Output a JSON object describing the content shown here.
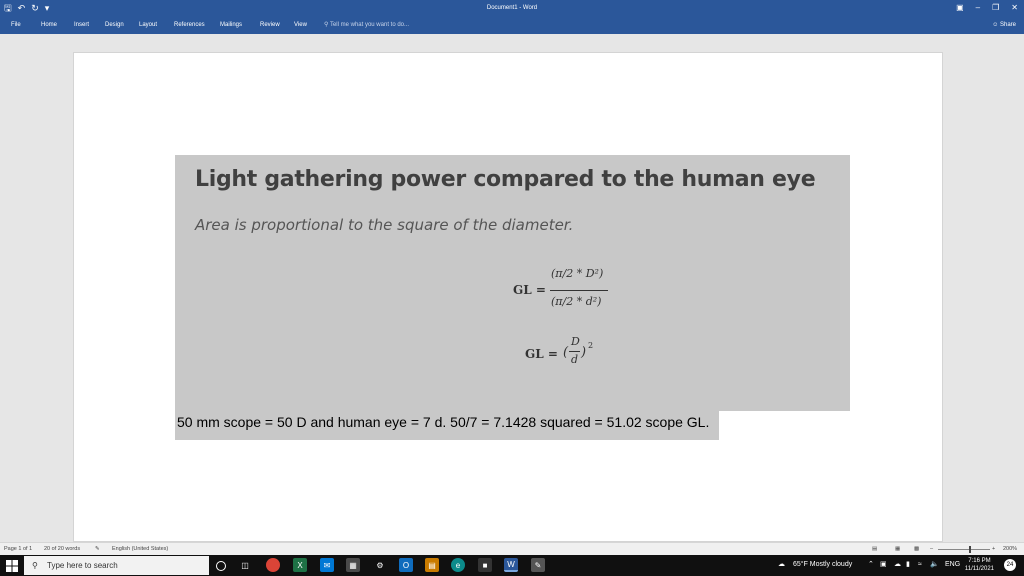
{
  "titlebar": {
    "title": "Document1 - Word",
    "qat_icons": [
      "save-icon",
      "undo-icon",
      "redo-icon",
      "customize-icon"
    ],
    "window_controls": [
      "ribbon-display-icon",
      "minimize-icon",
      "restore-icon",
      "close-icon"
    ]
  },
  "ribbon": {
    "tabs": [
      "File",
      "Home",
      "Insert",
      "Design",
      "Layout",
      "References",
      "Mailings",
      "Review",
      "View"
    ],
    "tell_me": "Tell me what you want to do...",
    "share": "Share"
  },
  "document": {
    "slide_title": "Light gathering power compared to the human eye",
    "slide_subtitle": "Area is proportional to the square of the diameter.",
    "formula1": {
      "lhs": "GL =",
      "numerator": "(π/2 * D²)",
      "denominator": "(π/2 * d²)"
    },
    "formula2": {
      "lhs": "GL =",
      "rhs_num": "D",
      "rhs_den": "d",
      "exponent": "2"
    },
    "equation_line": "50 mm scope = 50 D and human eye = 7 d.  50/7 = 7.1428 squared = 51.02 scope GL."
  },
  "statusbar": {
    "page": "Page 1 of 1",
    "words": "20 of 20 words",
    "language": "English (United States)",
    "zoom": "200%"
  },
  "taskbar": {
    "search_placeholder": "Type here to search",
    "weather": "65°F  Mostly cloudy",
    "lang": "ENG",
    "time": "7:16 PM",
    "date": "11/11/2021",
    "notifications": "24"
  }
}
